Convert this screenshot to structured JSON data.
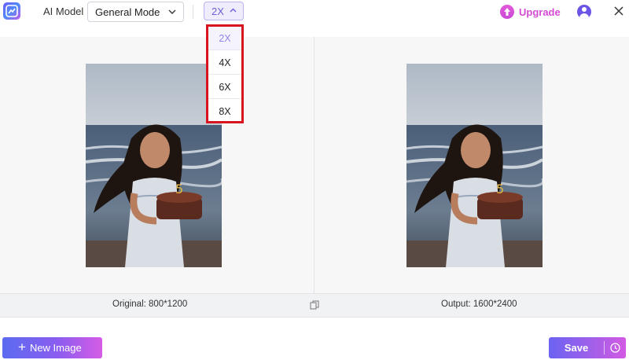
{
  "topbar": {
    "app_logo_icon": "enhancer-logo-icon",
    "model_label": "AI Model",
    "mode_value": "General Mode",
    "scale_value": "2X",
    "upgrade_label": "Upgrade",
    "avatar_icon": "user-avatar-icon",
    "close_icon": "close-icon"
  },
  "dropdown": {
    "options": [
      "2X",
      "4X",
      "6X",
      "8X"
    ],
    "selected": "2X",
    "highlight_color": "#d8141f"
  },
  "panels": {
    "original_label": "Original: 800*1200",
    "output_label": "Output: 1600*2400",
    "compare_icon": "copy-compare-icon"
  },
  "bottom": {
    "new_image_label": "New Image",
    "save_label": "Save",
    "history_icon": "clock-icon"
  },
  "colors": {
    "accent": "#6a5fd9",
    "upgrade": "#d54bd5",
    "gradient_start": "#5b6bf0",
    "gradient_end": "#d55ce5"
  }
}
